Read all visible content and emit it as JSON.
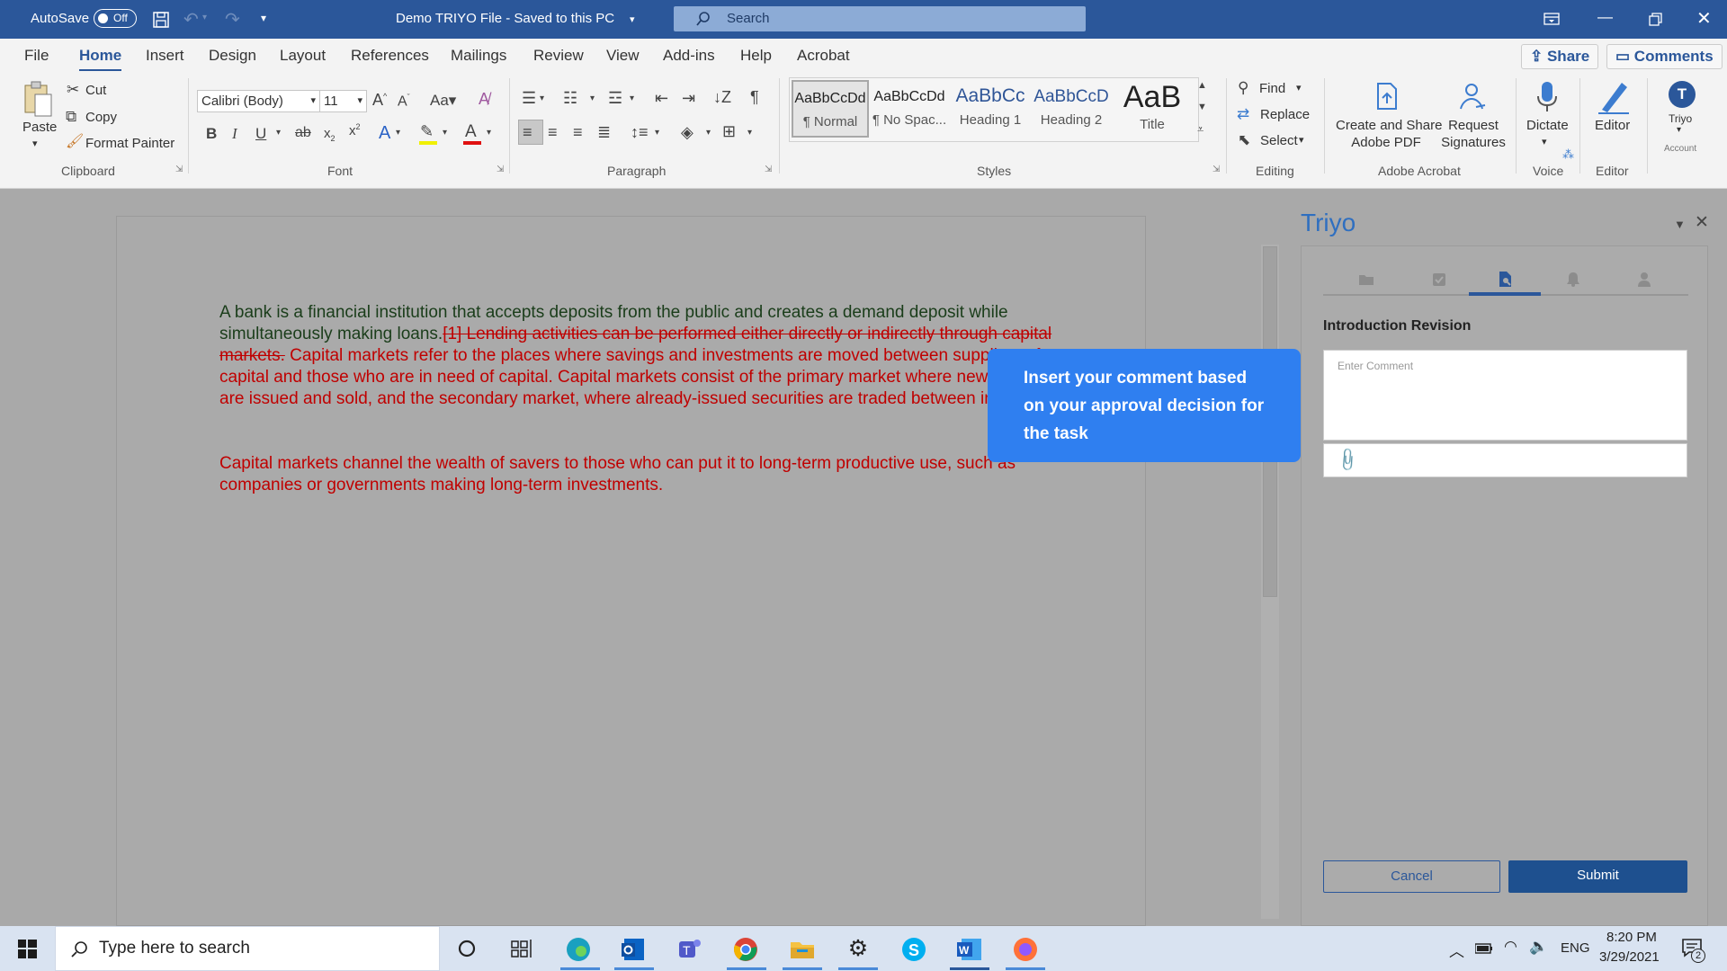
{
  "title_bar": {
    "autosave_label": "AutoSave",
    "autosave_state": "Off",
    "doc_title": "Demo TRIYO File - Saved to this PC",
    "search_placeholder": "Search"
  },
  "tabs": [
    "File",
    "Home",
    "Insert",
    "Design",
    "Layout",
    "References",
    "Mailings",
    "Review",
    "View",
    "Add-ins",
    "Help",
    "Acrobat"
  ],
  "share_label": "Share",
  "comments_label": "Comments",
  "ribbon": {
    "clipboard": {
      "paste": "Paste",
      "cut": "Cut",
      "copy": "Copy",
      "format_painter": "Format Painter",
      "group": "Clipboard"
    },
    "font": {
      "name": "Calibri (Body)",
      "size": "11",
      "group": "Font"
    },
    "paragraph": {
      "group": "Paragraph"
    },
    "styles": {
      "items": [
        {
          "preview": "AaBbCcDd",
          "name": "¶ Normal"
        },
        {
          "preview": "AaBbCcDd",
          "name": "¶ No Spac..."
        },
        {
          "preview": "AaBbCc",
          "name": "Heading 1"
        },
        {
          "preview": "AaBbCcD",
          "name": "Heading 2"
        },
        {
          "preview": "AaB",
          "name": "Title"
        }
      ],
      "group": "Styles"
    },
    "editing": {
      "find": "Find",
      "replace": "Replace",
      "select": "Select",
      "group": "Editing"
    },
    "acrobat": {
      "create_share_1": "Create and Share",
      "create_share_2": "Adobe PDF",
      "request_1": "Request",
      "request_2": "Signatures",
      "group": "Adobe Acrobat"
    },
    "voice": {
      "dictate": "Dictate",
      "group": "Voice"
    },
    "editor": {
      "editor": "Editor",
      "group": "Editor"
    },
    "account": {
      "user": "Triyo",
      "label": "Account"
    }
  },
  "document": {
    "p1_normal": "A bank is a financial institution that accepts deposits from the public and creates a demand deposit while simultaneously making loans.",
    "p1_deleted": "[1] Lending activities can be performed either directly or indirectly through capital markets.",
    "p1_inserted": " Capital markets refer to the places where savings and investments are moved between suppliers of capital and those who are in need of capital. Capital markets consist of the primary market where new securities are issued and sold, and the secondary market, where already-issued securities are traded between investors.",
    "p2_inserted": "Capital markets channel the wealth of savers to those who can put it to long-term productive use, such as companies or governments making long-term investments."
  },
  "tooltip": "Insert your comment based on your approval decision for the task",
  "triyo_pane": {
    "title": "Triyo",
    "section_title": "Introduction Revision",
    "comment_placeholder": "Enter Comment",
    "cancel_label": "Cancel",
    "submit_label": "Submit"
  },
  "taskbar": {
    "search_placeholder": "Type here to search",
    "language": "ENG",
    "time": "8:20 PM",
    "date": "3/29/2021",
    "notification_count": "2"
  },
  "colors": {
    "word_blue": "#2b579a",
    "tooltip_blue": "#2f7ff0",
    "revision_red": "#c00000"
  }
}
